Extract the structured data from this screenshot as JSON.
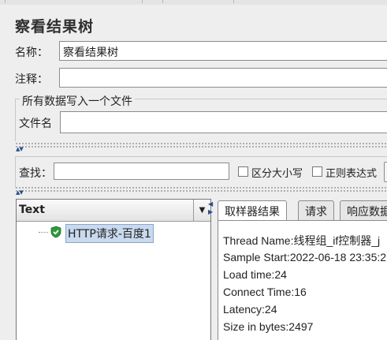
{
  "panel": {
    "title": "察看结果树",
    "name_label": "名称：",
    "name_value": "察看结果树",
    "comment_label": "注释：",
    "comment_value": "",
    "file_group_title": "所有数据写入一个文件",
    "filename_label": "文件名",
    "filename_value": ""
  },
  "search": {
    "label": "查找：",
    "value": "",
    "case_sensitive_label": "区分大小写",
    "regex_label": "正则表达式"
  },
  "tree": {
    "column_header": "Text",
    "nodes": [
      {
        "label": "HTTP请求-百度1",
        "status": "success"
      }
    ]
  },
  "tabs": [
    {
      "label": "取样器结果",
      "selected": true
    },
    {
      "label": "请求",
      "selected": false
    },
    {
      "label": "响应数据",
      "selected": false
    }
  ],
  "sampler_result": {
    "lines": [
      "Thread Name:线程组_if控制器_j",
      "Sample Start:2022-06-18 23:35:2",
      "Load time:24",
      "Connect Time:16",
      "Latency:24",
      "Size in bytes:2497"
    ]
  },
  "colors": {
    "background": "#eeeeee",
    "selection": "#c9d9ee",
    "success_icon": "#2e9a3a"
  },
  "icons": {
    "tree_node_status": "shield-check-icon",
    "dropdown": "triangle-down-icon"
  }
}
